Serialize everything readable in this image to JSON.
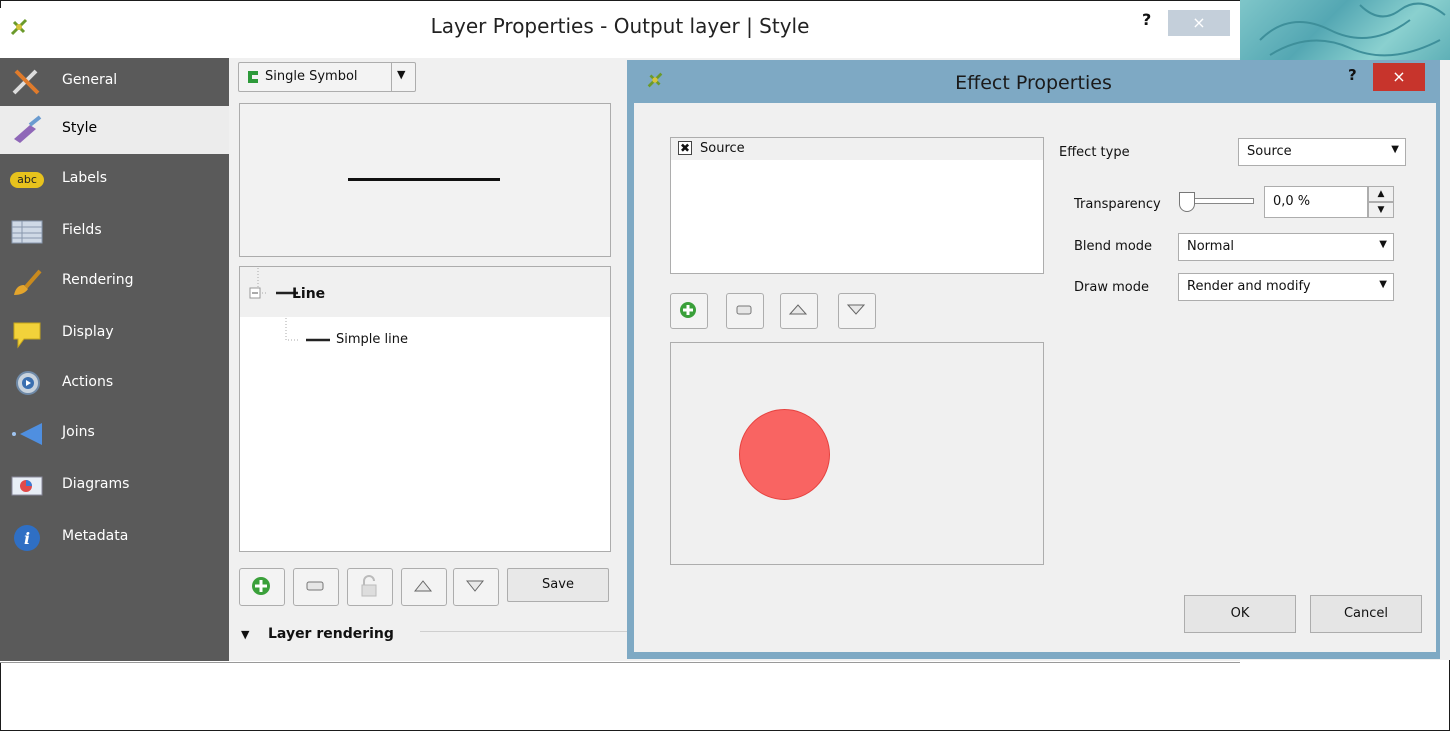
{
  "main_window": {
    "title": "Layer Properties - Output layer | Style",
    "help_label": "?",
    "close_label": "×"
  },
  "sidebar": {
    "items": [
      {
        "label": "General",
        "icon": "tools-icon"
      },
      {
        "label": "Style",
        "icon": "paintbrush-icon"
      },
      {
        "label": "Labels",
        "icon": "abc-labels-icon"
      },
      {
        "label": "Fields",
        "icon": "table-icon"
      },
      {
        "label": "Rendering",
        "icon": "brush-icon"
      },
      {
        "label": "Display",
        "icon": "speech-bubble-icon"
      },
      {
        "label": "Actions",
        "icon": "gear-play-icon"
      },
      {
        "label": "Joins",
        "icon": "join-arrow-icon"
      },
      {
        "label": "Diagrams",
        "icon": "chart-icon"
      },
      {
        "label": "Metadata",
        "icon": "info-icon"
      }
    ],
    "active": "Style",
    "labels_badge": "abc"
  },
  "style_panel": {
    "renderer": "Single Symbol",
    "tree": {
      "root": "Line",
      "child": "Simple line"
    },
    "save_label": "Save",
    "section_label": "Layer rendering"
  },
  "effect_dialog": {
    "title": "Effect Properties",
    "help_label": "?",
    "close_label": "×",
    "effects_list": [
      {
        "label": "Source",
        "checked": true
      }
    ],
    "effect_type_label": "Effect type",
    "effect_type_value": "Source",
    "transparency_label": "Transparency",
    "transparency_value": "0,0 %",
    "transparency_level": 0,
    "blend_mode_label": "Blend mode",
    "blend_mode_value": "Normal",
    "draw_mode_label": "Draw mode",
    "draw_mode_value": "Render and modify",
    "ok_label": "OK",
    "cancel_label": "Cancel",
    "preview_color": "#f96462"
  },
  "colors": {
    "sidebar_bg": "#5a5a5a",
    "dialog_frame": "#7ea9c4",
    "close_red": "#c7342c"
  }
}
